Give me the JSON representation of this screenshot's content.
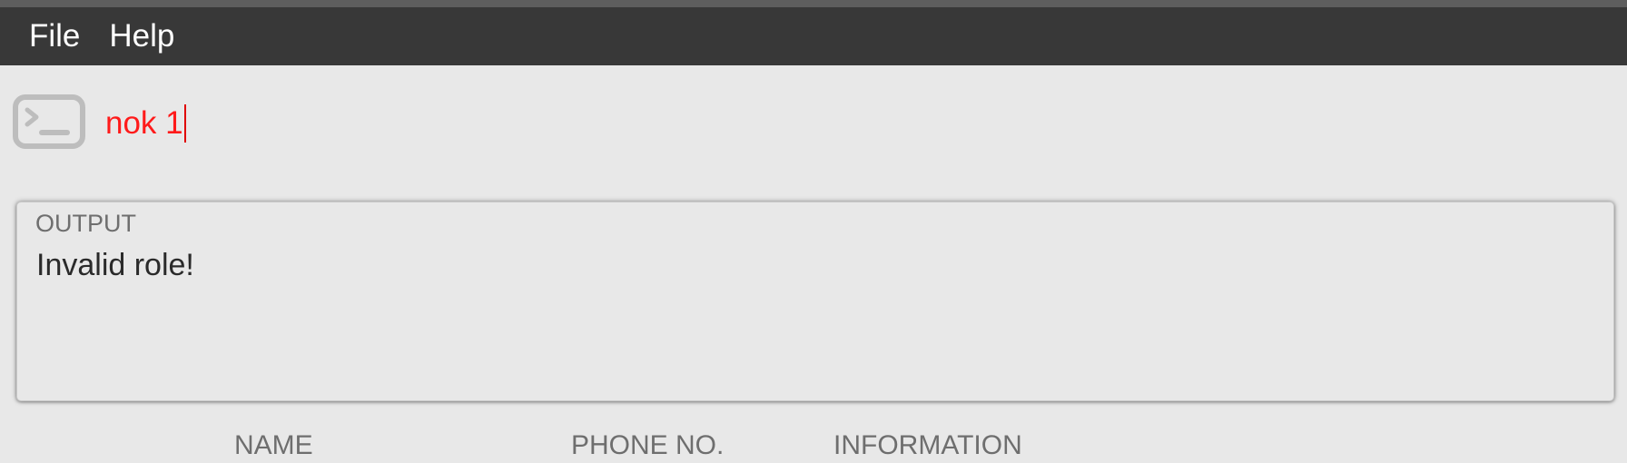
{
  "menubar": {
    "items": [
      {
        "label": "File"
      },
      {
        "label": "Help"
      }
    ]
  },
  "command": {
    "icon": "terminal-icon",
    "value": "nok 1",
    "text_color": "#ff1a1a"
  },
  "output": {
    "label": "OUTPUT",
    "message": "Invalid role!"
  },
  "table": {
    "headers": [
      "NAME",
      "PHONE NO.",
      "INFORMATION"
    ]
  }
}
